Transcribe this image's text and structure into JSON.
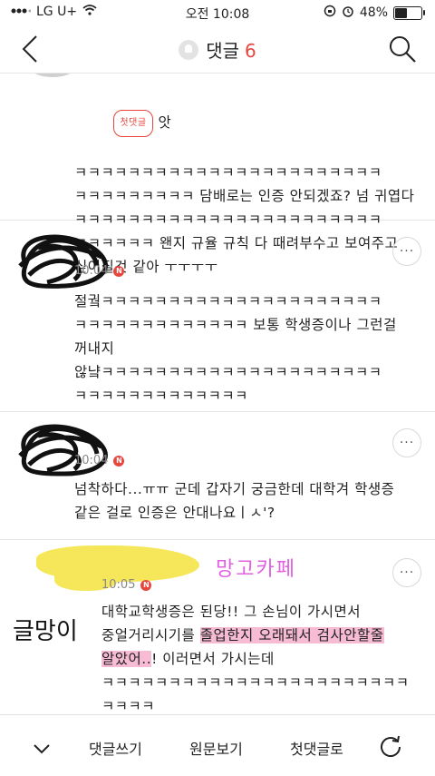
{
  "status": {
    "carrier": "LG U+",
    "time": "오전 10:08",
    "battery": "48%",
    "battery_level": 0.48
  },
  "header": {
    "title": "댓글",
    "count": "6"
  },
  "comments": [
    {
      "badge": "첫댓글",
      "first_word": "앗",
      "text": "ㅋㅋㅋㅋㅋㅋㅋㅋㅋㅋㅋㅋㅋㅋㅋㅋㅋㅋㅋㅋㅋㅋㅋ\nㅋㅋㅋㅋㅋㅋㅋㅋㅋ 담배로는 인증 안되겠죠? 넘 귀엽다\nㅋㅋㅋㅋㅋㅋㅋㅋㅋㅋㅋㅋㅋㅋㅋㅋㅋㅋㅋㅋㅋㅋㅋ\nㅋㅋㅋㅋㅋㅋ 왠지 규율 규칙 다 때려부수고 보여주고\n싶어질것 같아 ㅜㅜㅜㅜ"
    },
    {
      "time": "10:04",
      "text": "절궠ㅋㅋㅋㅋㅋㅋㅋㅋㅋㅋㅋㅋㅋㅋㅋㅋㅋㅋㅋㅋㅋ\nㅋㅋㅋㅋㅋㅋㅋㅋㅋㅋㅋㅋㅋ 보통 학생증이나 그런걸\n꺼내지\n않냨ㅋㅋㅋㅋㅋㅋㅋㅋㅋㅋㅋㅋㅋㅋㅋㅋㅋㅋㅋㅋㅋ\nㅋㅋㅋㅋㅋㅋㅋㅋㅋㅋㅋㅋㅋ"
    },
    {
      "time": "10:04",
      "text": "넘착하다...ㅠㅠ 군데 갑자기 궁금한데 대학겨 학생증\n같은 걸로 인증은 안대나요ㅣㅅ'?"
    },
    {
      "time": "10:05",
      "handwritten_name": "글망이",
      "handwritten_label": "망고카페",
      "line1": "대학교학생증은 된당!! 그 손님이 가시면서",
      "line2_a": "중얼거리시기를 ",
      "line2_hl": "졸업한지 오래돼서 검사안할줄",
      "line3_hl": "알았어..",
      "line3_b": "! 이러면서 가시는데",
      "line4": "ㅋㅋㅋㅋㅋㅋㅋㅋㅋㅋㅋㅋㅋㅋㅋㅋㅋㅋㅋㅋㅋㅋㅋ",
      "line5": "ㅋㅋㅋㅋ"
    }
  ],
  "more_label": "···",
  "bottom": {
    "write": "댓글쓰기",
    "view_original": "원문보기",
    "first_comment": "첫댓글로"
  },
  "colors": {
    "accent": "#e8453c",
    "highlight": "#f7bcd3",
    "label": "#e060e0"
  }
}
